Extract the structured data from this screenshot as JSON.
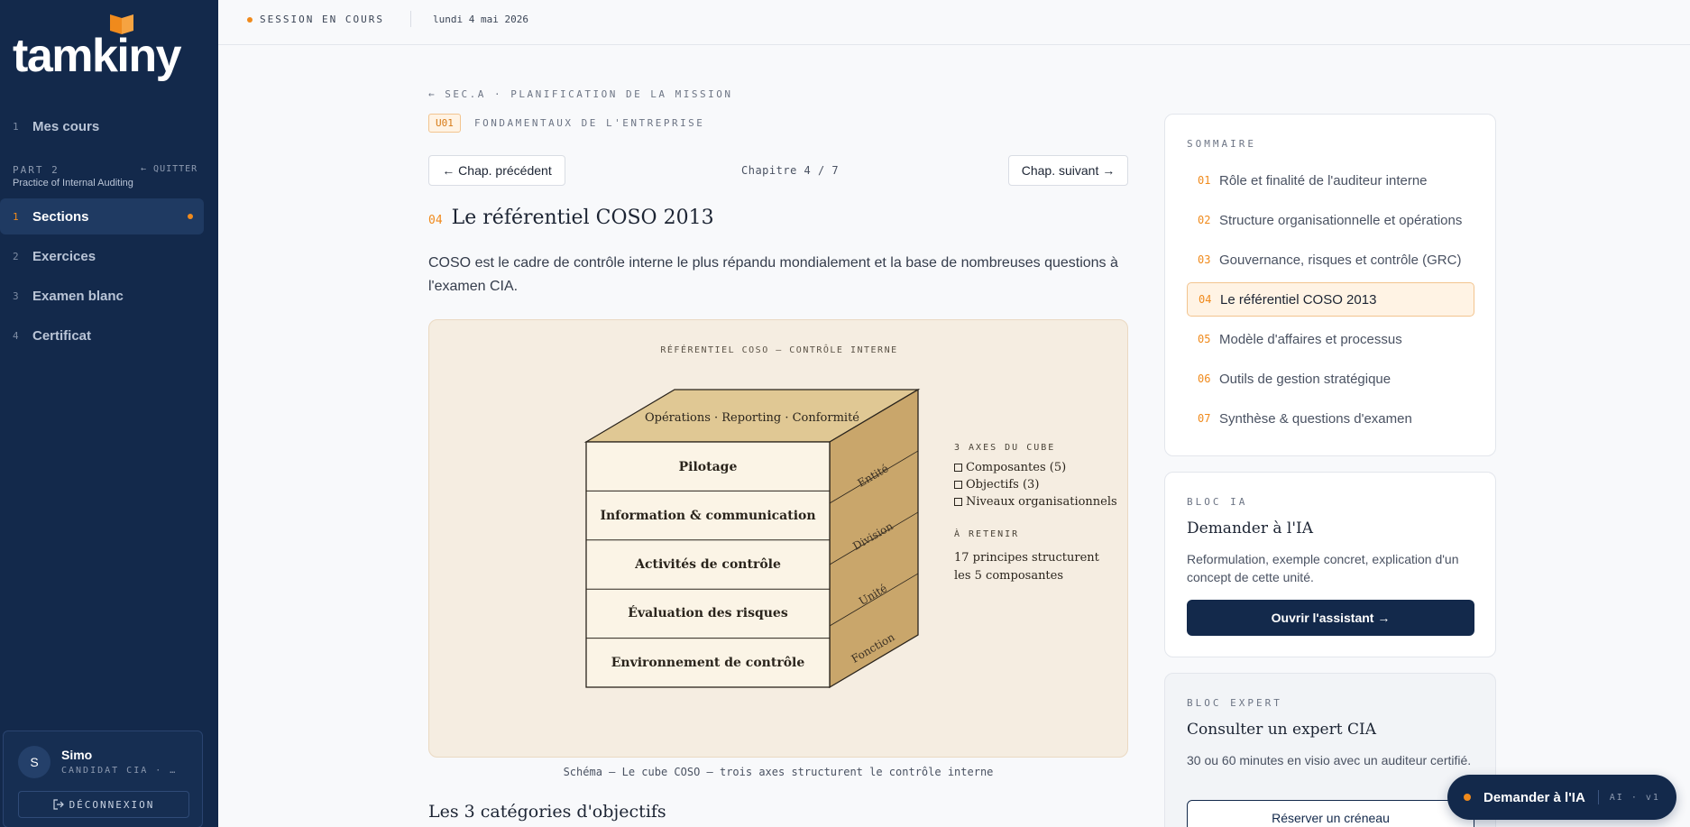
{
  "sidebar": {
    "logo": "tamkiny",
    "items": [
      {
        "num": "1",
        "label": "Mes cours"
      },
      {
        "num": "1",
        "label": "Sections"
      },
      {
        "num": "2",
        "label": "Exercices"
      },
      {
        "num": "3",
        "label": "Examen blanc"
      },
      {
        "num": "4",
        "label": "Certificat"
      }
    ],
    "part_label": "PART 2",
    "part_sub": "Practice of Internal Auditing",
    "quit_label": "QUITTER",
    "user": {
      "initial": "S",
      "name": "Simo",
      "role": "CANDIDAT CIA · …",
      "logout": "DÉCONNEXION"
    }
  },
  "topbar": {
    "session": "SESSION EN COURS",
    "date": "lundi 4 mai 2026"
  },
  "main": {
    "breadcrumb": "← SEC.A · PLANIFICATION DE LA MISSION",
    "unit_tag": "U01",
    "unit_title": "FONDAMENTAUX DE L'ENTREPRISE",
    "prev": "← Chap. précédent",
    "next": "Chap. suivant →",
    "chapter_count": "Chapitre 4 / 7",
    "chapter_num": "04",
    "chapter_title": "Le référentiel COSO 2013",
    "intro": "COSO est le cadre de contrôle interne le plus répandu mondialement et la base de nombreuses questions à l'examen CIA.",
    "figure": {
      "title": "RÉFÉRENTIEL COSO — CONTRÔLE INTERNE",
      "top_face": "Opérations · Reporting · Conformité",
      "layers": [
        "Pilotage",
        "Information & communication",
        "Activités de contrôle",
        "Évaluation des risques",
        "Environnement de contrôle"
      ],
      "side": [
        "Entité",
        "Division",
        "Unité",
        "Fonction"
      ],
      "axes_title": "3 AXES DU CUBE",
      "axes": [
        "Composantes (5)",
        "Objectifs (3)",
        "Niveaux organisationnels"
      ],
      "retain_title": "À RETENIR",
      "retain_text": "17 principes structurent les 5 composantes"
    },
    "caption": "Schéma — Le cube COSO — trois axes structurent le contrôle interne",
    "sub_heading": "Les 3 catégories d'objectifs"
  },
  "toc": {
    "label": "SOMMAIRE",
    "items": [
      {
        "num": "01",
        "label": "Rôle et finalité de l'auditeur interne"
      },
      {
        "num": "02",
        "label": "Structure organisationnelle et opérations"
      },
      {
        "num": "03",
        "label": "Gouvernance, risques et contrôle (GRC)"
      },
      {
        "num": "04",
        "label": "Le référentiel COSO 2013"
      },
      {
        "num": "05",
        "label": "Modèle d'affaires et processus"
      },
      {
        "num": "06",
        "label": "Outils de gestion stratégique"
      },
      {
        "num": "07",
        "label": "Synthèse & questions d'examen"
      }
    ]
  },
  "ai_block": {
    "label": "BLOC IA",
    "title": "Demander à l'IA",
    "text": "Reformulation, exemple concret, explication d'un concept de cette unité.",
    "button": "Ouvrir l'assistant →"
  },
  "expert_block": {
    "label": "BLOC EXPERT",
    "title": "Consulter un expert CIA",
    "text": "30 ou 60 minutes en visio avec un auditeur certifié.",
    "button": "Réserver un créneau"
  },
  "fab": {
    "label": "Demander à l'IA",
    "version": "AI · v1"
  },
  "colors": {
    "navy": "#13294b",
    "accent": "#f08a1c",
    "figure_bg": "#f5ede1"
  }
}
